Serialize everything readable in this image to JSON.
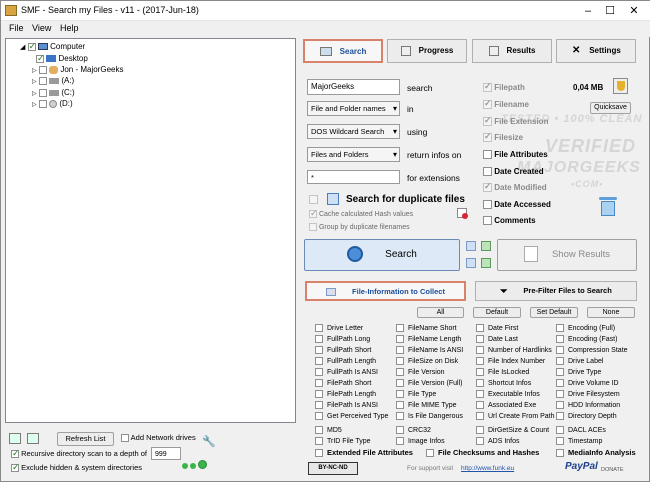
{
  "window": {
    "title": "SMF - Search my Files - v11 - (2017-Jun-18)"
  },
  "menu": [
    "File",
    "View",
    "Help"
  ],
  "tree": [
    {
      "label": "Computer",
      "checked": true
    },
    {
      "label": "Desktop",
      "checked": true
    },
    {
      "label": "Jon - MajorGeeks",
      "checked": false
    },
    {
      "label": "(A:)",
      "checked": false
    },
    {
      "label": "(C:)",
      "checked": false
    },
    {
      "label": "(D:)",
      "checked": false
    }
  ],
  "tabs": [
    "Search",
    "Progress",
    "Results",
    "Settings"
  ],
  "search": {
    "value": "MajorGeeks",
    "search_label": "search",
    "names_select": "File and Folder names",
    "in_label": "in",
    "wildcard_select": "DOS Wildcard Search",
    "using_label": "using",
    "scope_select": "Files and Folders",
    "return_label": "return infos on",
    "ext_value": "*",
    "ext_label": "for extensions",
    "dup_label": "Search for duplicate files",
    "hash_label": "Cache calculated Hash values",
    "group_label": "Group by duplicate filenames"
  },
  "info_opts": [
    {
      "label": "Filepath",
      "checked": true,
      "enabled": false
    },
    {
      "label": "Filename",
      "checked": true,
      "enabled": false
    },
    {
      "label": "File Extension",
      "checked": true,
      "enabled": false
    },
    {
      "label": "Filesize",
      "checked": true,
      "enabled": false
    },
    {
      "label": "File Attributes",
      "checked": false,
      "enabled": true
    },
    {
      "label": "Date Created",
      "checked": false,
      "enabled": true
    },
    {
      "label": "Date Modified",
      "checked": true,
      "enabled": false
    },
    {
      "label": "Date Accessed",
      "checked": false,
      "enabled": true
    },
    {
      "label": "Comments",
      "checked": false,
      "enabled": true
    }
  ],
  "size_text": "0,04 MB",
  "quicksave_label": "Quicksave",
  "search_button": "Search",
  "show_results_button": "Show Results",
  "file_info_tab": "File-Information to Collect",
  "prefilter_tab": "Pre-Filter Files to Search",
  "preset_buttons": [
    "All",
    "Default",
    "Set Default",
    "None"
  ],
  "fields": [
    [
      "Drive Letter",
      "FullPath Long",
      "FullPath Short",
      "FullPath Length",
      "FullPath Is ANSI",
      "FilePath Short",
      "FilePath Length",
      "FilePath Is ANSI",
      "Get Perceived Type"
    ],
    [
      "FileName Short",
      "FileName Length",
      "FileName Is ANSI",
      "FileSize on Disk",
      "File Version",
      "File Version (Full)",
      "File Type",
      "File MIME Type",
      "Is File Dangerous"
    ],
    [
      "Date First",
      "Date Last",
      "Number of Hardlinks",
      "File Index Number",
      "File IsLocked",
      "Shortcut Infos",
      "Executable Infos",
      "Associated Exe",
      "Url Create From Path"
    ],
    [
      "Encoding (Full)",
      "Encoding (Fast)",
      "Compression State",
      "Drive Label",
      "Drive Type",
      "Drive Volume ID",
      "Drive Filesystem",
      "HDD Information",
      "Directory Depth"
    ]
  ],
  "extra_rows": [
    [
      "MD5",
      "CRC32",
      "DirGetSize & Count",
      "DACL ACEs"
    ],
    [
      "TrID File Type",
      "Image Infos",
      "ADS Infos",
      "Timestamp"
    ]
  ],
  "bottom_opts": [
    "Extended File Attributes",
    "File Checksums and Hashes",
    "MediaInfo Analysis"
  ],
  "left_bottom": {
    "refresh_label": "Refresh List",
    "network_label": "Add Network drives",
    "recursive_label": "Recursive directory scan to a depth of",
    "depth": "999",
    "exclude_label": "Exclude hidden & system directories"
  },
  "footer": {
    "support_label": "For support visit",
    "url": "http://www.funk.eu",
    "license": "BY-NC-ND",
    "paypal": "PayPal",
    "donate": "DONATE"
  },
  "watermark": [
    "TESTED • 100% CLEAN",
    "VERIFIED",
    "MAJORGEEKS",
    "•COM•"
  ]
}
